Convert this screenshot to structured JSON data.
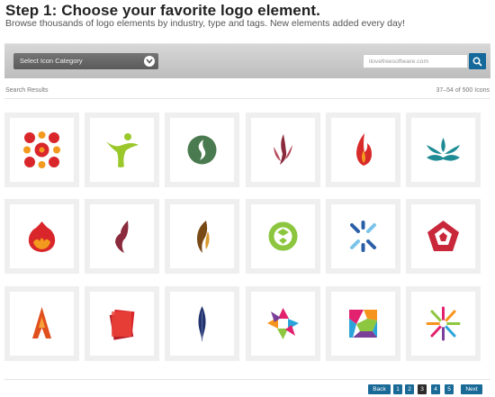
{
  "header": {
    "title": "Step 1: Choose your favorite logo element.",
    "subtitle": "Browse thousands of logo elements by industry, type and tags. New elements added every day!"
  },
  "toolbar": {
    "category_select": "Select Icon Category",
    "search_placeholder": "ilovefreesoftware.com",
    "search_icon": "search-icon",
    "dropdown_icon": "chevron-down-icon"
  },
  "results": {
    "label": "Search Results",
    "count": "37–54 of 500 Icons"
  },
  "icons": [
    {
      "name": "red-molecule-cross",
      "colors": [
        "#d9262b",
        "#f39a1e"
      ]
    },
    {
      "name": "green-dancing-figure",
      "colors": [
        "#9ac82b"
      ]
    },
    {
      "name": "green-circle-s-leaf",
      "colors": [
        "#4a7a4f",
        "#ffffff"
      ]
    },
    {
      "name": "maroon-flame-plant",
      "colors": [
        "#8a2a3c"
      ]
    },
    {
      "name": "red-flame",
      "colors": [
        "#d92a2a"
      ]
    },
    {
      "name": "teal-lotus-ornament",
      "colors": [
        "#1f8c95"
      ]
    },
    {
      "name": "red-fireball",
      "colors": [
        "#d9262b",
        "#f39a1e"
      ]
    },
    {
      "name": "maroon-wing-swoosh",
      "colors": [
        "#8a2a3c"
      ]
    },
    {
      "name": "brown-leaf-flame",
      "colors": [
        "#7a4a16",
        "#d99a2e"
      ]
    },
    {
      "name": "green-recycle-ring",
      "colors": [
        "#8cc63f"
      ]
    },
    {
      "name": "blue-burst-lines",
      "colors": [
        "#2a5fa8",
        "#7cc3ea"
      ]
    },
    {
      "name": "red-pentagon-star",
      "colors": [
        "#c8283a"
      ]
    },
    {
      "name": "orange-rocket-a",
      "colors": [
        "#e0501c",
        "#f9a23a"
      ]
    },
    {
      "name": "red-stacked-pages",
      "colors": [
        "#d9262b"
      ]
    },
    {
      "name": "navy-feather",
      "colors": [
        "#22336e"
      ]
    },
    {
      "name": "multicolor-swirl-star",
      "colors": [
        "#e2216f",
        "#2aa4da",
        "#8dc63f",
        "#f7941d"
      ]
    },
    {
      "name": "multicolor-square-puzzle",
      "colors": [
        "#e2216f",
        "#2aa4da",
        "#8dc63f",
        "#f7941d"
      ]
    },
    {
      "name": "multicolor-burst-people",
      "colors": [
        "#e2216f",
        "#2aa4da",
        "#8dc63f",
        "#f7941d"
      ]
    }
  ],
  "pagination": {
    "back": "Back",
    "pages": [
      "1",
      "2",
      "3",
      "4",
      "5"
    ],
    "current": "3",
    "next": "Next"
  },
  "colors": {
    "accent": "#1a6a98",
    "toolbar": "#c8c8c8",
    "tile_border": "#efefef"
  }
}
